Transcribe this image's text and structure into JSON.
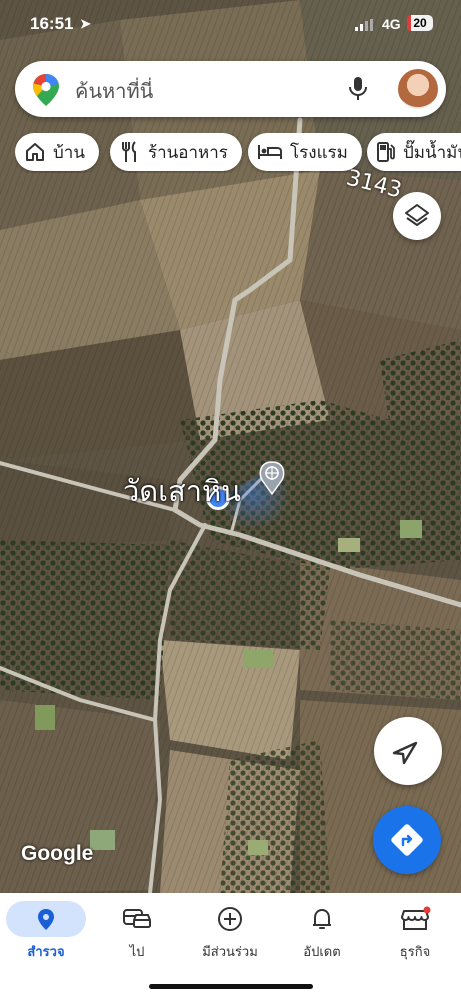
{
  "status_bar": {
    "time": "16:51",
    "network": "4G",
    "battery": "20"
  },
  "search": {
    "placeholder": "ค้นหาที่นี่"
  },
  "chips": [
    {
      "label": "บ้าน",
      "icon": "home-icon"
    },
    {
      "label": "ร้านอาหาร",
      "icon": "restaurant-icon"
    },
    {
      "label": "โรงแรม",
      "icon": "hotel-icon"
    },
    {
      "label": "ปั๊มน้ำมัน",
      "icon": "gas-station-icon"
    }
  ],
  "map": {
    "place_label": "วัดเสาหิน",
    "road_label": "3143",
    "attribution": "Google"
  },
  "nav": [
    {
      "label": "สำรวจ",
      "icon": "explore-pin-icon",
      "active": true
    },
    {
      "label": "ไป",
      "icon": "commute-icon",
      "active": false
    },
    {
      "label": "มีส่วนร่วม",
      "icon": "contribute-icon",
      "active": false
    },
    {
      "label": "อัปเดต",
      "icon": "updates-bell-icon",
      "active": false
    },
    {
      "label": "ธุรกิจ",
      "icon": "business-store-icon",
      "active": false
    }
  ],
  "colors": {
    "accent": "#1a73e8",
    "active_pill": "#d3e3fd",
    "location_dot": "#4285f4"
  }
}
